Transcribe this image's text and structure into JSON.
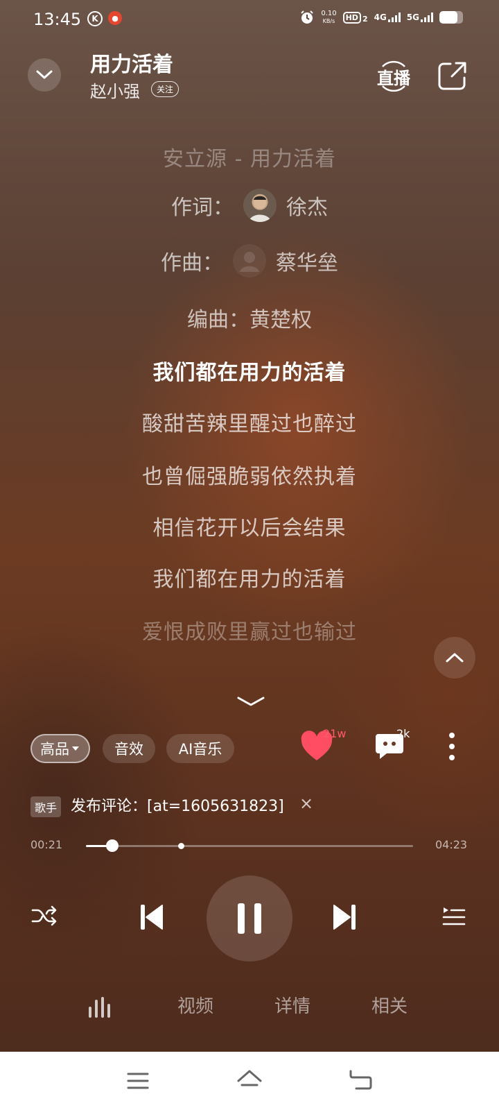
{
  "status_bar": {
    "time": "13:45",
    "speed_value": "0.10",
    "speed_unit": "KB/s",
    "hd_label": "HD",
    "hd_sub": "2",
    "net1": "4G",
    "net2": "5G",
    "battery_level": 0.75
  },
  "header": {
    "title": "用力活着",
    "artist": "赵小强",
    "follow_label": "关注",
    "live_label": "直播"
  },
  "lyrics": {
    "heading": "安立源 - 用力活着",
    "lyricist_label": "作词：",
    "lyricist": "徐杰",
    "composer_label": "作曲：",
    "composer": "蔡华垒",
    "arranger_label": "编曲：",
    "arranger": "黄楚权",
    "lines": [
      "我们都在用力的活着",
      "酸甜苦辣里醒过也醉过",
      "也曾倔强脆弱依然执着",
      "相信花开以后会结果",
      "我们都在用力的活着",
      "爱恨成败里赢过也输过"
    ],
    "active_index": 0
  },
  "actions": {
    "quality_label": "高品",
    "effects_label": "音效",
    "ai_label": "AI音乐",
    "like_count": "21w",
    "comment_count": "2k"
  },
  "comment": {
    "tag": "歌手",
    "text": "发布评论：[at=1605631823]",
    "close": "×"
  },
  "progress": {
    "current": "00:21",
    "total": "04:23",
    "fraction": 0.08,
    "marker_fraction": 0.29
  },
  "tabs": {
    "video": "视频",
    "details": "详情",
    "related": "相关"
  },
  "colors": {
    "like": "#ff4d63",
    "text": "#ffffff"
  }
}
